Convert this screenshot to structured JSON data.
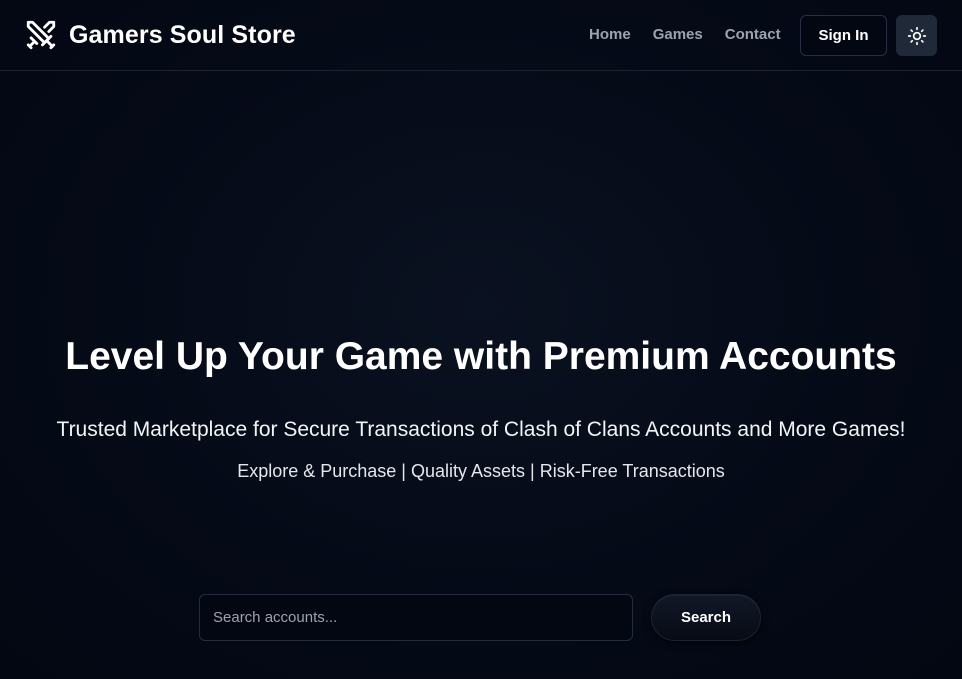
{
  "header": {
    "brand_name": "Gamers Soul Store",
    "brand_icon": "crossed-swords-icon",
    "nav": [
      {
        "label": "Home"
      },
      {
        "label": "Games"
      },
      {
        "label": "Contact"
      }
    ],
    "sign_in_label": "Sign In",
    "theme_toggle_icon": "sun-icon"
  },
  "hero": {
    "title": "Level Up Your Game with Premium Accounts",
    "subtitle": "Trusted Marketplace for Secure Transactions of Clash of Clans Accounts and More Games!",
    "tagline": "Explore & Purchase | Quality Assets | Risk-Free Transactions"
  },
  "search": {
    "placeholder": "Search accounts...",
    "value": "",
    "button_label": "Search"
  },
  "colors": {
    "background": "#030712",
    "text": "#ffffff",
    "nav_text": "#9ca3af",
    "theme_button_bg": "#1f2937"
  }
}
